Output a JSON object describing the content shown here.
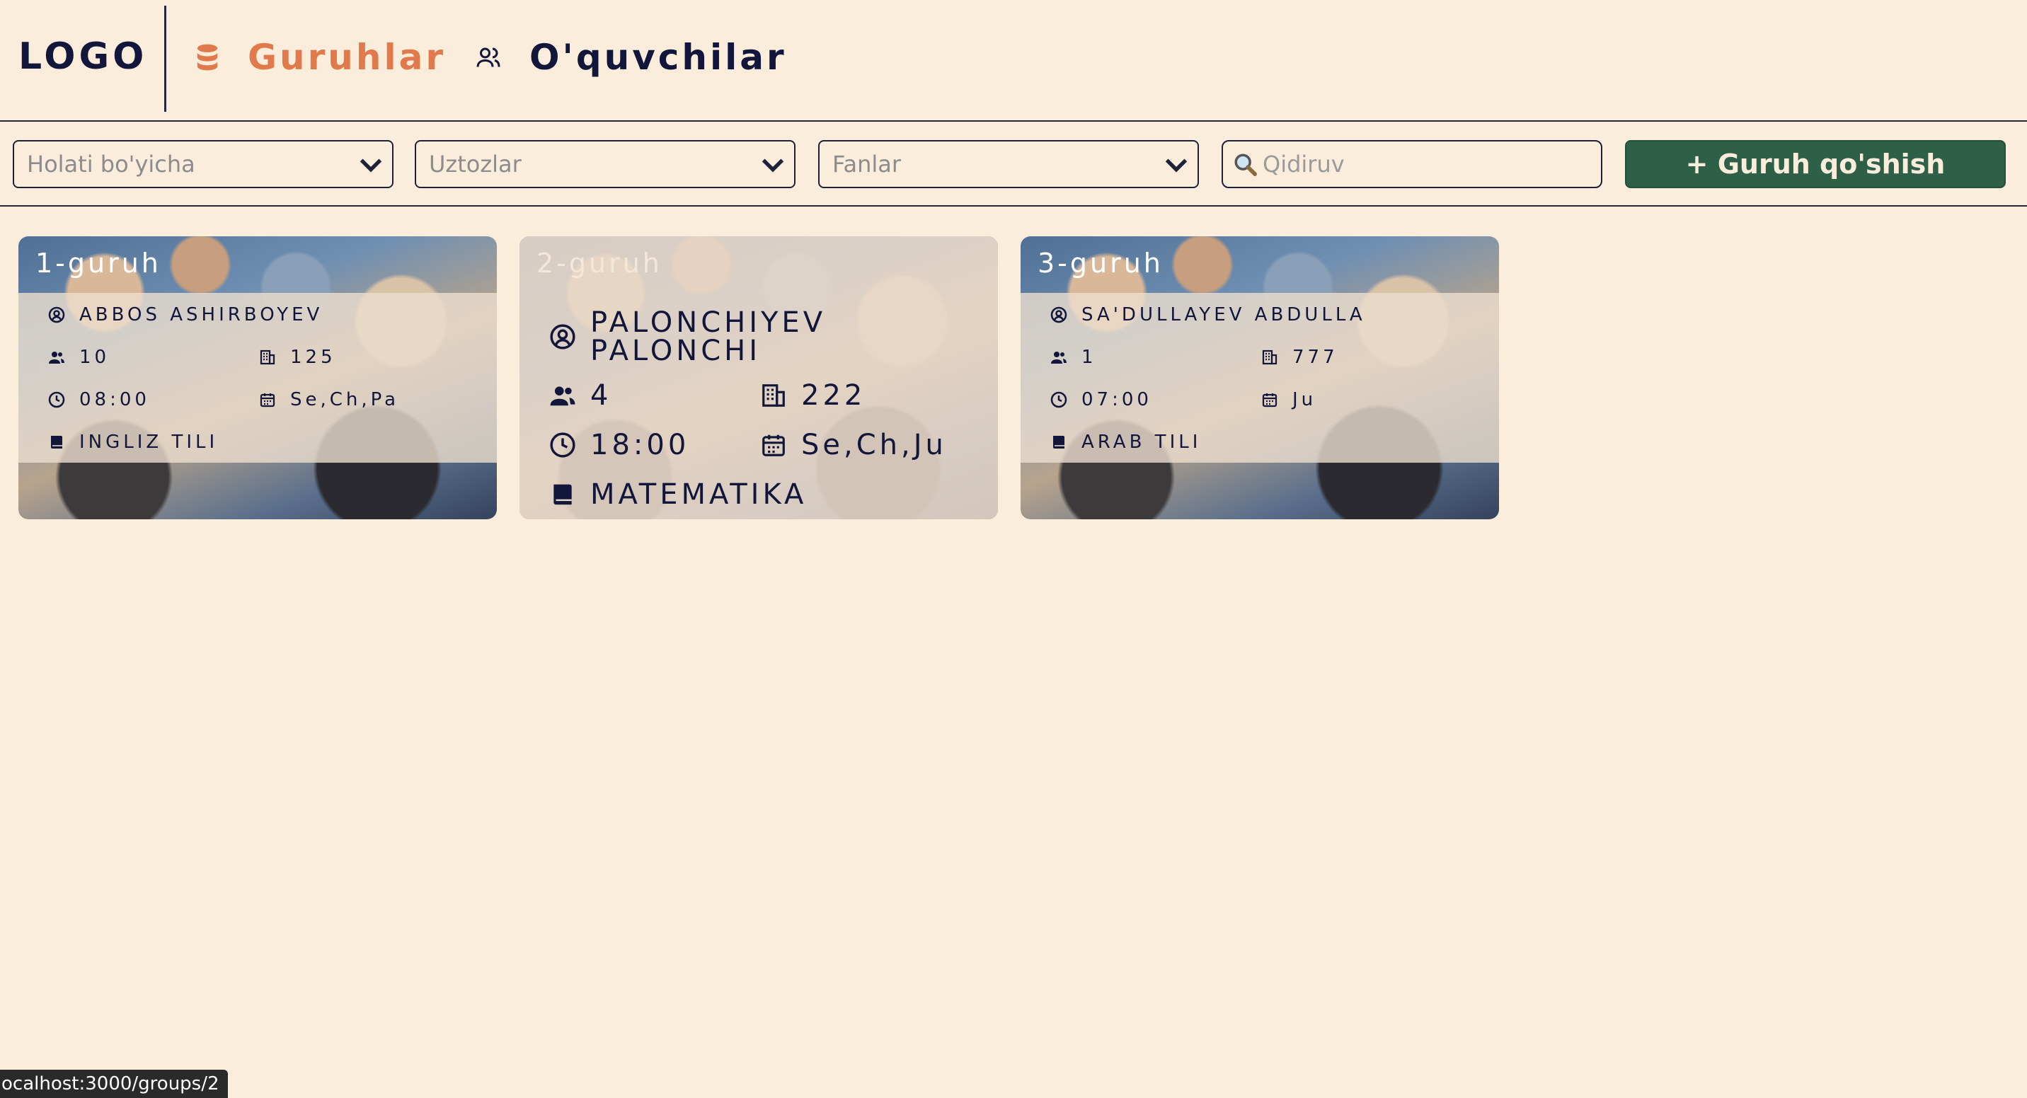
{
  "header": {
    "logo": "LOGO",
    "nav": [
      {
        "label": "Guruhlar",
        "icon": "database-icon",
        "active": true
      },
      {
        "label": "O'quvchilar",
        "icon": "users-icon",
        "active": false
      }
    ]
  },
  "toolbar": {
    "status_select": "Holati bo'yicha",
    "teachers_select": "Uztozlar",
    "subjects_select": "Fanlar",
    "search_placeholder": "Qidiruv",
    "add_button": "+ Guruh qo'shish"
  },
  "groups": [
    {
      "title": "1-guruh",
      "teacher": "ABBOS ASHIRBOYEV",
      "students": "10",
      "room": "125",
      "time": "08:00",
      "days": "Se,Ch,Pa",
      "subject": "INGLIZ TILI"
    },
    {
      "title": "2-guruh",
      "teacher_line1": "PALONCHIYEV",
      "teacher_line2": "PALONCHI",
      "students": "4",
      "room": "222",
      "time": "18:00",
      "days": "Se,Ch,Ju",
      "subject": "MATEMATIKA"
    },
    {
      "title": "3-guruh",
      "teacher": "SA'DULLAYEV ABDULLA",
      "students": "1",
      "room": "777",
      "time": "07:00",
      "days": "Ju",
      "subject": "ARAB TILI"
    }
  ],
  "status_bar": "ocalhost:3000/groups/2",
  "colors": {
    "background": "#fbeddb",
    "accent": "#e07a4c",
    "primary_button": "#2e6048",
    "text": "#12163a"
  }
}
